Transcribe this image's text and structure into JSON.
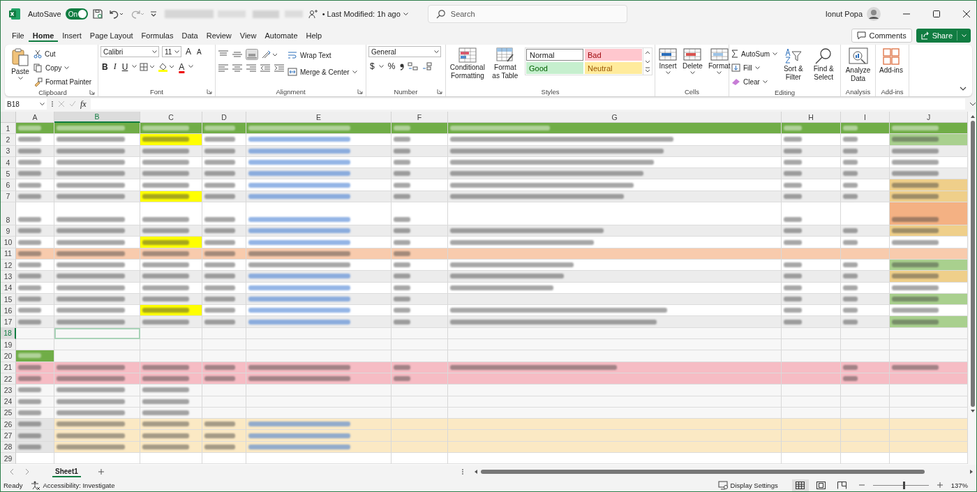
{
  "title_bar": {
    "autosave": {
      "label": "AutoSave",
      "on": true,
      "state_text": "On"
    },
    "last_modified": "• Last Modified: 1h ago",
    "search": {
      "placeholder": "Search"
    },
    "user": "Ionut Popa"
  },
  "menu": [
    {
      "label": "File",
      "selected": false
    },
    {
      "label": "Home",
      "selected": true
    },
    {
      "label": "Insert",
      "selected": false
    },
    {
      "label": "Page Layout",
      "selected": false
    },
    {
      "label": "Formulas",
      "selected": false
    },
    {
      "label": "Data",
      "selected": false
    },
    {
      "label": "Review",
      "selected": false
    },
    {
      "label": "View",
      "selected": false
    },
    {
      "label": "Automate",
      "selected": false
    },
    {
      "label": "Help",
      "selected": false
    }
  ],
  "comments": "Comments",
  "share": "Share",
  "ribbon": {
    "clipboard": {
      "label": "Clipboard",
      "paste": "Paste",
      "cut": "Cut",
      "copy": "Copy",
      "format_painter": "Format Painter"
    },
    "font": {
      "label": "Font",
      "family": "Calibri",
      "size": "11",
      "grow": "A",
      "shrink": "A",
      "bold": "B",
      "italic": "I",
      "underline": "U",
      "font_color": "A"
    },
    "alignment": {
      "label": "Alignment",
      "wrap": "Wrap Text",
      "merge": "Merge & Center"
    },
    "number": {
      "label": "Number",
      "format": "General",
      "currency": "$",
      "percent": "%"
    },
    "styles": {
      "label": "Styles",
      "conditional": "Conditional Formatting",
      "format_table": "Format as Table",
      "cells": [
        {
          "label": "Normal",
          "color": "#ffffff"
        },
        {
          "label": "Bad",
          "color": "#ffc7ce"
        },
        {
          "label": "Good",
          "color": "#c6efce"
        },
        {
          "label": "Neutral",
          "color": "#ffeb9c"
        }
      ]
    },
    "cells": {
      "label": "Cells",
      "insert": "Insert",
      "delete": "Delete",
      "format": "Format"
    },
    "editing": {
      "label": "Editing",
      "autosum": "AutoSum",
      "fill": "Fill",
      "clear": "Clear",
      "sort": "Sort & Filter",
      "find": "Find & Select"
    },
    "analysis": {
      "label": "Analysis",
      "analyze": "Analyze Data"
    },
    "addins": {
      "label": "Add-ins",
      "addins": "Add-ins"
    }
  },
  "formula_bar": {
    "name_box": "B18",
    "fx": "fx"
  },
  "columns": [
    {
      "label": "A",
      "selected": false
    },
    {
      "label": "B",
      "selected": true
    },
    {
      "label": "C",
      "selected": false
    },
    {
      "label": "D",
      "selected": false
    },
    {
      "label": "E",
      "selected": false
    },
    {
      "label": "F",
      "selected": false
    },
    {
      "label": "G",
      "selected": false
    },
    {
      "label": "H",
      "selected": false
    },
    {
      "label": "I",
      "selected": false
    },
    {
      "label": "J",
      "selected": false
    }
  ],
  "rows": [
    {
      "number": "1",
      "selected": false,
      "kind": "normal",
      "color": "#70ad47",
      "cells": [
        {
          "kind": "head"
        },
        {
          "kind": "head"
        },
        {
          "kind": "head"
        },
        {
          "kind": "head"
        },
        {
          "kind": "head"
        },
        {
          "kind": "head"
        },
        {
          "kind": "head"
        },
        {
          "kind": "head"
        },
        {
          "kind": "head"
        },
        {
          "kind": "head"
        }
      ]
    },
    {
      "number": "2",
      "selected": false,
      "kind": "normal",
      "color": "#ffffff",
      "cells": [
        {
          "kind": "text"
        },
        {
          "kind": "text"
        },
        {
          "kind": "text",
          "color": "#ffff00"
        },
        {
          "kind": "text"
        },
        {
          "kind": "link"
        },
        {
          "kind": "text"
        },
        {
          "kind": "text"
        },
        {
          "kind": "text"
        },
        {
          "kind": "text"
        },
        {
          "kind": "text",
          "color": "#a9d08e"
        }
      ]
    },
    {
      "number": "3",
      "selected": false,
      "kind": "normal",
      "color": "#ececec",
      "cells": [
        {
          "kind": "text"
        },
        {
          "kind": "text"
        },
        {
          "kind": "text"
        },
        {
          "kind": "text"
        },
        {
          "kind": "link"
        },
        {
          "kind": "text"
        },
        {
          "kind": "text"
        },
        {
          "kind": "text"
        },
        {
          "kind": "text"
        },
        {
          "kind": "text"
        }
      ]
    },
    {
      "number": "4",
      "selected": false,
      "kind": "normal",
      "color": "#ffffff",
      "cells": [
        {
          "kind": "text"
        },
        {
          "kind": "text"
        },
        {
          "kind": "text"
        },
        {
          "kind": "text"
        },
        {
          "kind": "link"
        },
        {
          "kind": "text"
        },
        {
          "kind": "text"
        },
        {
          "kind": "text"
        },
        {
          "kind": "text"
        },
        {
          "kind": "text"
        }
      ]
    },
    {
      "number": "5",
      "selected": false,
      "kind": "normal",
      "color": "#ececec",
      "cells": [
        {
          "kind": "text"
        },
        {
          "kind": "text"
        },
        {
          "kind": "text"
        },
        {
          "kind": "text"
        },
        {
          "kind": "link"
        },
        {
          "kind": "text"
        },
        {
          "kind": "text"
        },
        {
          "kind": "text"
        },
        {
          "kind": "text"
        },
        {
          "kind": "text"
        }
      ]
    },
    {
      "number": "6",
      "selected": false,
      "kind": "normal",
      "color": "#ffffff",
      "cells": [
        {
          "kind": "text"
        },
        {
          "kind": "text"
        },
        {
          "kind": "text"
        },
        {
          "kind": "text"
        },
        {
          "kind": "link"
        },
        {
          "kind": "text"
        },
        {
          "kind": "text"
        },
        {
          "kind": "text"
        },
        {
          "kind": "text"
        },
        {
          "kind": "text",
          "color": "#efcf8a"
        }
      ]
    },
    {
      "number": "7",
      "selected": false,
      "kind": "normal",
      "color": "#ececec",
      "cells": [
        {
          "kind": "text"
        },
        {
          "kind": "text"
        },
        {
          "kind": "text",
          "color": "#ffff00"
        },
        {
          "kind": "text"
        },
        {
          "kind": "link"
        },
        {
          "kind": "text"
        },
        {
          "kind": "text"
        },
        {
          "kind": "text"
        },
        {
          "kind": "text"
        },
        {
          "kind": "text",
          "color": "#efcf8a"
        }
      ]
    },
    {
      "number": "8",
      "selected": false,
      "kind": "tall",
      "color": "#ffffff",
      "cells": [
        {
          "kind": "text"
        },
        {
          "kind": "text"
        },
        {
          "kind": "text"
        },
        {
          "kind": "text"
        },
        {
          "kind": "link"
        },
        {
          "kind": "text"
        },
        {
          "kind": "empty"
        },
        {
          "kind": "text"
        },
        {
          "kind": "empty"
        },
        {
          "kind": "text",
          "color": "#f4b183"
        }
      ]
    },
    {
      "number": "9",
      "selected": false,
      "kind": "normal",
      "color": "#ececec",
      "cells": [
        {
          "kind": "text"
        },
        {
          "kind": "text"
        },
        {
          "kind": "text"
        },
        {
          "kind": "text"
        },
        {
          "kind": "link"
        },
        {
          "kind": "text"
        },
        {
          "kind": "text"
        },
        {
          "kind": "text"
        },
        {
          "kind": "text"
        },
        {
          "kind": "text",
          "color": "#efcf8a"
        }
      ]
    },
    {
      "number": "10",
      "selected": false,
      "kind": "normal",
      "color": "#ffffff",
      "cells": [
        {
          "kind": "text"
        },
        {
          "kind": "text"
        },
        {
          "kind": "text",
          "color": "#ffff00"
        },
        {
          "kind": "text"
        },
        {
          "kind": "link"
        },
        {
          "kind": "text"
        },
        {
          "kind": "text"
        },
        {
          "kind": "text"
        },
        {
          "kind": "text"
        },
        {
          "kind": "text"
        }
      ]
    },
    {
      "number": "11",
      "selected": false,
      "kind": "normal",
      "color": "#f8cbad",
      "cells": [
        {
          "kind": "text"
        },
        {
          "kind": "text"
        },
        {
          "kind": "text"
        },
        {
          "kind": "text"
        },
        {
          "kind": "text"
        },
        {
          "kind": "text"
        },
        {
          "kind": "empty"
        },
        {
          "kind": "empty"
        },
        {
          "kind": "empty"
        },
        {
          "kind": "empty"
        }
      ]
    },
    {
      "number": "12",
      "selected": false,
      "kind": "normal",
      "color": "#ffffff",
      "cells": [
        {
          "kind": "text"
        },
        {
          "kind": "text"
        },
        {
          "kind": "text"
        },
        {
          "kind": "text"
        },
        {
          "kind": "text"
        },
        {
          "kind": "text"
        },
        {
          "kind": "text"
        },
        {
          "kind": "text"
        },
        {
          "kind": "text"
        },
        {
          "kind": "text",
          "color": "#a9d08e"
        }
      ]
    },
    {
      "number": "13",
      "selected": false,
      "kind": "normal",
      "color": "#ececec",
      "cells": [
        {
          "kind": "text"
        },
        {
          "kind": "text"
        },
        {
          "kind": "text"
        },
        {
          "kind": "text"
        },
        {
          "kind": "link"
        },
        {
          "kind": "text"
        },
        {
          "kind": "text"
        },
        {
          "kind": "text"
        },
        {
          "kind": "text"
        },
        {
          "kind": "text",
          "color": "#efcf8a"
        }
      ]
    },
    {
      "number": "14",
      "selected": false,
      "kind": "normal",
      "color": "#ffffff",
      "cells": [
        {
          "kind": "text"
        },
        {
          "kind": "text"
        },
        {
          "kind": "text"
        },
        {
          "kind": "text"
        },
        {
          "kind": "link"
        },
        {
          "kind": "text"
        },
        {
          "kind": "text"
        },
        {
          "kind": "text"
        },
        {
          "kind": "text"
        },
        {
          "kind": "text"
        }
      ]
    },
    {
      "number": "15",
      "selected": false,
      "kind": "normal",
      "color": "#ececec",
      "cells": [
        {
          "kind": "text"
        },
        {
          "kind": "text"
        },
        {
          "kind": "text"
        },
        {
          "kind": "text"
        },
        {
          "kind": "link"
        },
        {
          "kind": "text"
        },
        {
          "kind": "empty"
        },
        {
          "kind": "text"
        },
        {
          "kind": "text"
        },
        {
          "kind": "text",
          "color": "#a9d08e"
        }
      ]
    },
    {
      "number": "16",
      "selected": false,
      "kind": "normal",
      "color": "#ffffff",
      "cells": [
        {
          "kind": "text"
        },
        {
          "kind": "text"
        },
        {
          "kind": "text",
          "color": "#ffff00"
        },
        {
          "kind": "text"
        },
        {
          "kind": "link"
        },
        {
          "kind": "text"
        },
        {
          "kind": "text"
        },
        {
          "kind": "text"
        },
        {
          "kind": "text"
        },
        {
          "kind": "text"
        }
      ]
    },
    {
      "number": "17",
      "selected": false,
      "kind": "normal",
      "color": "#ececec",
      "cells": [
        {
          "kind": "text"
        },
        {
          "kind": "text"
        },
        {
          "kind": "text"
        },
        {
          "kind": "text"
        },
        {
          "kind": "link"
        },
        {
          "kind": "text"
        },
        {
          "kind": "text"
        },
        {
          "kind": "text"
        },
        {
          "kind": "text"
        },
        {
          "kind": "text",
          "color": "#a9d08e"
        }
      ]
    },
    {
      "number": "18",
      "selected": true,
      "kind": "normal",
      "color": "#f7f7f7",
      "cells": [
        {
          "kind": "empty"
        },
        {
          "kind": "empty"
        },
        {
          "kind": "empty"
        },
        {
          "kind": "empty"
        },
        {
          "kind": "empty"
        },
        {
          "kind": "empty"
        },
        {
          "kind": "empty"
        },
        {
          "kind": "empty"
        },
        {
          "kind": "empty"
        },
        {
          "kind": "empty"
        }
      ]
    },
    {
      "number": "19",
      "selected": false,
      "kind": "normal",
      "color": "#f7f7f7",
      "cells": [
        {
          "kind": "empty"
        },
        {
          "kind": "empty"
        },
        {
          "kind": "empty"
        },
        {
          "kind": "empty"
        },
        {
          "kind": "empty"
        },
        {
          "kind": "empty"
        },
        {
          "kind": "empty"
        },
        {
          "kind": "empty"
        },
        {
          "kind": "empty"
        },
        {
          "kind": "empty"
        }
      ]
    },
    {
      "number": "20",
      "selected": false,
      "kind": "normal",
      "color": "#f7f7f7",
      "cells": [
        {
          "kind": "head",
          "color": "#70ad47"
        },
        {
          "kind": "empty"
        },
        {
          "kind": "empty"
        },
        {
          "kind": "empty"
        },
        {
          "kind": "empty"
        },
        {
          "kind": "empty"
        },
        {
          "kind": "empty"
        },
        {
          "kind": "empty"
        },
        {
          "kind": "empty"
        },
        {
          "kind": "empty"
        }
      ]
    },
    {
      "number": "21",
      "selected": false,
      "kind": "normal",
      "color": "#f6bcc4",
      "cells": [
        {
          "kind": "text"
        },
        {
          "kind": "text"
        },
        {
          "kind": "text"
        },
        {
          "kind": "text"
        },
        {
          "kind": "text"
        },
        {
          "kind": "text"
        },
        {
          "kind": "text"
        },
        {
          "kind": "empty"
        },
        {
          "kind": "text"
        },
        {
          "kind": "text"
        }
      ]
    },
    {
      "number": "22",
      "selected": false,
      "kind": "normal",
      "color": "#f6bcc4",
      "cells": [
        {
          "kind": "text"
        },
        {
          "kind": "text"
        },
        {
          "kind": "text"
        },
        {
          "kind": "text"
        },
        {
          "kind": "text"
        },
        {
          "kind": "text"
        },
        {
          "kind": "empty"
        },
        {
          "kind": "empty"
        },
        {
          "kind": "text"
        },
        {
          "kind": "empty"
        }
      ]
    },
    {
      "number": "23",
      "selected": false,
      "kind": "normal",
      "color": "#f7f7f7",
      "cells": [
        {
          "kind": "text"
        },
        {
          "kind": "text"
        },
        {
          "kind": "text"
        },
        {
          "kind": "empty"
        },
        {
          "kind": "empty"
        },
        {
          "kind": "empty"
        },
        {
          "kind": "empty"
        },
        {
          "kind": "empty"
        },
        {
          "kind": "empty"
        },
        {
          "kind": "empty"
        }
      ]
    },
    {
      "number": "24",
      "selected": false,
      "kind": "normal",
      "color": "#f7f7f7",
      "cells": [
        {
          "kind": "text"
        },
        {
          "kind": "text"
        },
        {
          "kind": "text"
        },
        {
          "kind": "empty"
        },
        {
          "kind": "empty"
        },
        {
          "kind": "empty"
        },
        {
          "kind": "empty"
        },
        {
          "kind": "empty"
        },
        {
          "kind": "empty"
        },
        {
          "kind": "empty"
        }
      ]
    },
    {
      "number": "25",
      "selected": false,
      "kind": "normal",
      "color": "#f7f7f7",
      "cells": [
        {
          "kind": "text"
        },
        {
          "kind": "text"
        },
        {
          "kind": "text"
        },
        {
          "kind": "empty"
        },
        {
          "kind": "empty"
        },
        {
          "kind": "empty"
        },
        {
          "kind": "empty"
        },
        {
          "kind": "empty"
        },
        {
          "kind": "empty"
        },
        {
          "kind": "empty"
        }
      ]
    },
    {
      "number": "26",
      "selected": false,
      "kind": "normal",
      "color": "#fbe9c4",
      "cells": [
        {
          "kind": "text",
          "color": "#e4e4e4"
        },
        {
          "kind": "text"
        },
        {
          "kind": "text"
        },
        {
          "kind": "text"
        },
        {
          "kind": "link"
        },
        {
          "kind": "empty"
        },
        {
          "kind": "empty"
        },
        {
          "kind": "empty"
        },
        {
          "kind": "empty"
        },
        {
          "kind": "empty"
        }
      ]
    },
    {
      "number": "27",
      "selected": false,
      "kind": "normal",
      "color": "#fbe9c4",
      "cells": [
        {
          "kind": "text",
          "color": "#e4e4e4"
        },
        {
          "kind": "text"
        },
        {
          "kind": "text"
        },
        {
          "kind": "text"
        },
        {
          "kind": "link"
        },
        {
          "kind": "empty"
        },
        {
          "kind": "empty"
        },
        {
          "kind": "empty"
        },
        {
          "kind": "empty"
        },
        {
          "kind": "empty"
        }
      ]
    },
    {
      "number": "28",
      "selected": false,
      "kind": "normal",
      "color": "#fbe9c4",
      "cells": [
        {
          "kind": "text",
          "color": "#e4e4e4"
        },
        {
          "kind": "text"
        },
        {
          "kind": "text"
        },
        {
          "kind": "text"
        },
        {
          "kind": "link"
        },
        {
          "kind": "empty"
        },
        {
          "kind": "empty"
        },
        {
          "kind": "empty"
        },
        {
          "kind": "empty"
        },
        {
          "kind": "empty"
        }
      ]
    },
    {
      "number": "29",
      "selected": false,
      "kind": "normal",
      "color": "#ffffff",
      "cells": [
        {
          "kind": "empty"
        },
        {
          "kind": "empty"
        },
        {
          "kind": "empty"
        },
        {
          "kind": "empty"
        },
        {
          "kind": "empty"
        },
        {
          "kind": "empty"
        },
        {
          "kind": "empty"
        },
        {
          "kind": "empty"
        },
        {
          "kind": "empty"
        },
        {
          "kind": "empty"
        }
      ]
    }
  ],
  "sheets": [
    {
      "label": "Sheet1",
      "selected": true
    }
  ],
  "status_bar": {
    "ready": "Ready",
    "accessibility": "Accessibility: Investigate",
    "display_settings": "Display Settings",
    "views": [
      {
        "kind": "normal",
        "selected": true
      },
      {
        "kind": "page_layout",
        "selected": false
      },
      {
        "kind": "page_break",
        "selected": false
      }
    ],
    "zoom": {
      "level": 0.55,
      "text": "137%"
    }
  }
}
